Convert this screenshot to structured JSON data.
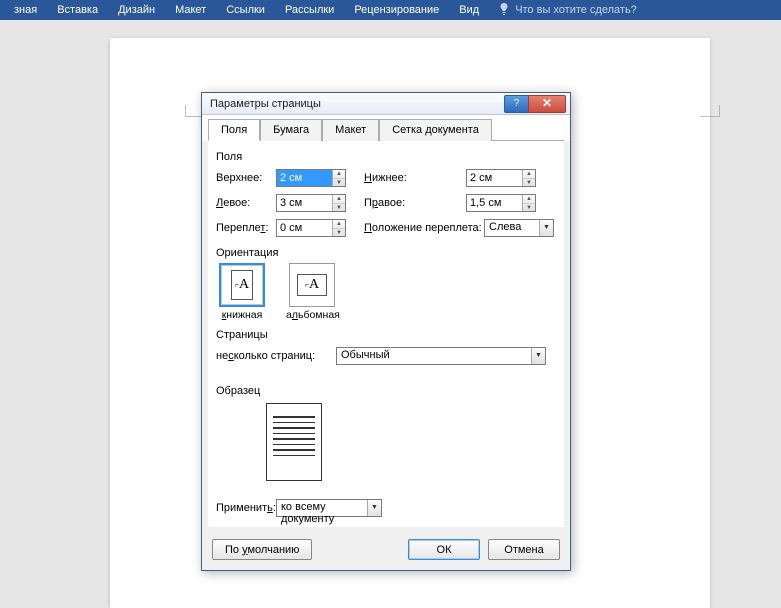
{
  "ribbon": {
    "tabs": [
      "зная",
      "Вставка",
      "Дизайн",
      "Макет",
      "Ссылки",
      "Рассылки",
      "Рецензирование",
      "Вид"
    ],
    "tellme": "Что вы хотите сделать?"
  },
  "dialog": {
    "title": "Параметры страницы",
    "tabs": {
      "t0": "Поля",
      "t1": "Бумага",
      "t2": "Макет",
      "t3": "Сетка документа"
    },
    "groups": {
      "margins": "Поля",
      "orientation": "Ориентация",
      "pages": "Страницы",
      "preview": "Образец"
    },
    "labels": {
      "top": "Верхнее:",
      "bottom": "Нижнее:",
      "left": "Левое:",
      "right": "Правое:",
      "gutter": "Переплет:",
      "gutter_pos": "Положение переплета:",
      "multipages": "несколько страниц:",
      "apply": "Применить:"
    },
    "values": {
      "top": "2 см",
      "bottom": "2 см",
      "left": "3 см",
      "right": "1,5 см",
      "gutter": "0 см",
      "gutter_pos": "Слева",
      "multipages": "Обычный",
      "apply": "ко всему документу"
    },
    "orientation": {
      "portrait": "книжная",
      "landscape": "альбомная"
    },
    "buttons": {
      "default": "По умолчанию",
      "ok": "ОК",
      "cancel": "Отмена"
    }
  }
}
